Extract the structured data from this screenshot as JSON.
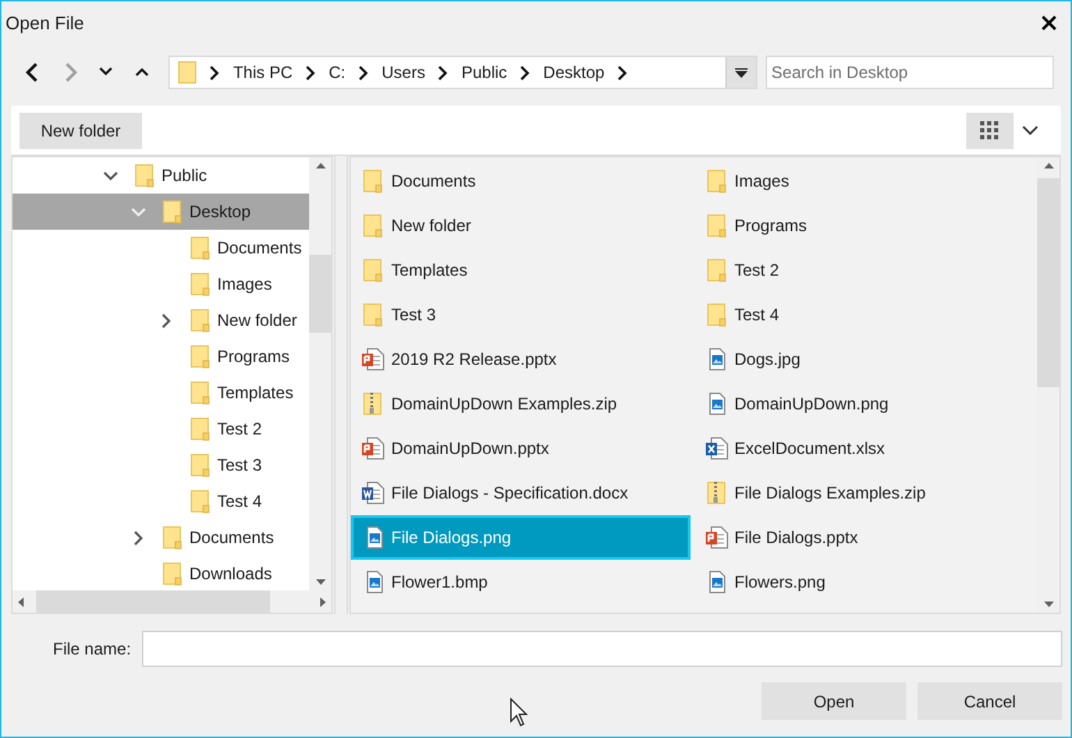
{
  "window": {
    "title": "Open File"
  },
  "nav_buttons": [
    {
      "kind": "back",
      "disabled": false
    },
    {
      "kind": "forward",
      "disabled": true
    },
    {
      "kind": "recent",
      "disabled": false
    },
    {
      "kind": "up",
      "disabled": false
    }
  ],
  "breadcrumb": [
    "This PC",
    "C:",
    "Users",
    "Public",
    "Desktop"
  ],
  "search": {
    "placeholder": "Search in Desktop"
  },
  "toolbar": {
    "new_folder": "New folder"
  },
  "tree": [
    {
      "label": "Public",
      "expandable": true,
      "expanded": true,
      "selected": false,
      "children": [
        {
          "label": "Desktop",
          "expandable": true,
          "expanded": true,
          "selected": true,
          "children": [
            {
              "label": "Documents",
              "expandable": false,
              "expanded": false,
              "selected": false
            },
            {
              "label": "Images",
              "expandable": false,
              "expanded": false,
              "selected": false
            },
            {
              "label": "New folder",
              "expandable": true,
              "expanded": false,
              "selected": false
            },
            {
              "label": "Programs",
              "expandable": false,
              "expanded": false,
              "selected": false
            },
            {
              "label": "Templates",
              "expandable": false,
              "expanded": false,
              "selected": false
            },
            {
              "label": "Test 2",
              "expandable": false,
              "expanded": false,
              "selected": false
            },
            {
              "label": "Test 3",
              "expandable": false,
              "expanded": false,
              "selected": false
            },
            {
              "label": "Test 4",
              "expandable": false,
              "expanded": false,
              "selected": false
            }
          ]
        },
        {
          "label": "Documents",
          "expandable": true,
          "expanded": false,
          "selected": false
        },
        {
          "label": "Downloads",
          "expandable": false,
          "expanded": false,
          "selected": false
        }
      ]
    }
  ],
  "files": [
    {
      "name": "Documents",
      "kind": "folder",
      "selected": false
    },
    {
      "name": "Images",
      "kind": "folder",
      "selected": false
    },
    {
      "name": "New folder",
      "kind": "folder",
      "selected": false
    },
    {
      "name": "Programs",
      "kind": "folder",
      "selected": false
    },
    {
      "name": "Templates",
      "kind": "folder",
      "selected": false
    },
    {
      "name": "Test 2",
      "kind": "folder",
      "selected": false
    },
    {
      "name": "Test 3",
      "kind": "folder",
      "selected": false
    },
    {
      "name": "Test 4",
      "kind": "folder",
      "selected": false
    },
    {
      "name": "2019 R2 Release.pptx",
      "kind": "pptx",
      "selected": false
    },
    {
      "name": "Dogs.jpg",
      "kind": "image",
      "selected": false
    },
    {
      "name": "DomainUpDown Examples.zip",
      "kind": "zip",
      "selected": false
    },
    {
      "name": "DomainUpDown.png",
      "kind": "image",
      "selected": false
    },
    {
      "name": "DomainUpDown.pptx",
      "kind": "pptx",
      "selected": false
    },
    {
      "name": "ExcelDocument.xlsx",
      "kind": "xlsx",
      "selected": false
    },
    {
      "name": "File Dialogs - Specification.docx",
      "kind": "docx",
      "selected": false
    },
    {
      "name": "File Dialogs Examples.zip",
      "kind": "zip",
      "selected": false
    },
    {
      "name": "File Dialogs.png",
      "kind": "image",
      "selected": true
    },
    {
      "name": "File Dialogs.pptx",
      "kind": "pptx",
      "selected": false
    },
    {
      "name": "Flower1.bmp",
      "kind": "image",
      "selected": false
    },
    {
      "name": "Flowers.png",
      "kind": "image",
      "selected": false
    }
  ],
  "file_name": {
    "label": "File name:"
  },
  "buttons": [
    "Open",
    "Cancel"
  ]
}
